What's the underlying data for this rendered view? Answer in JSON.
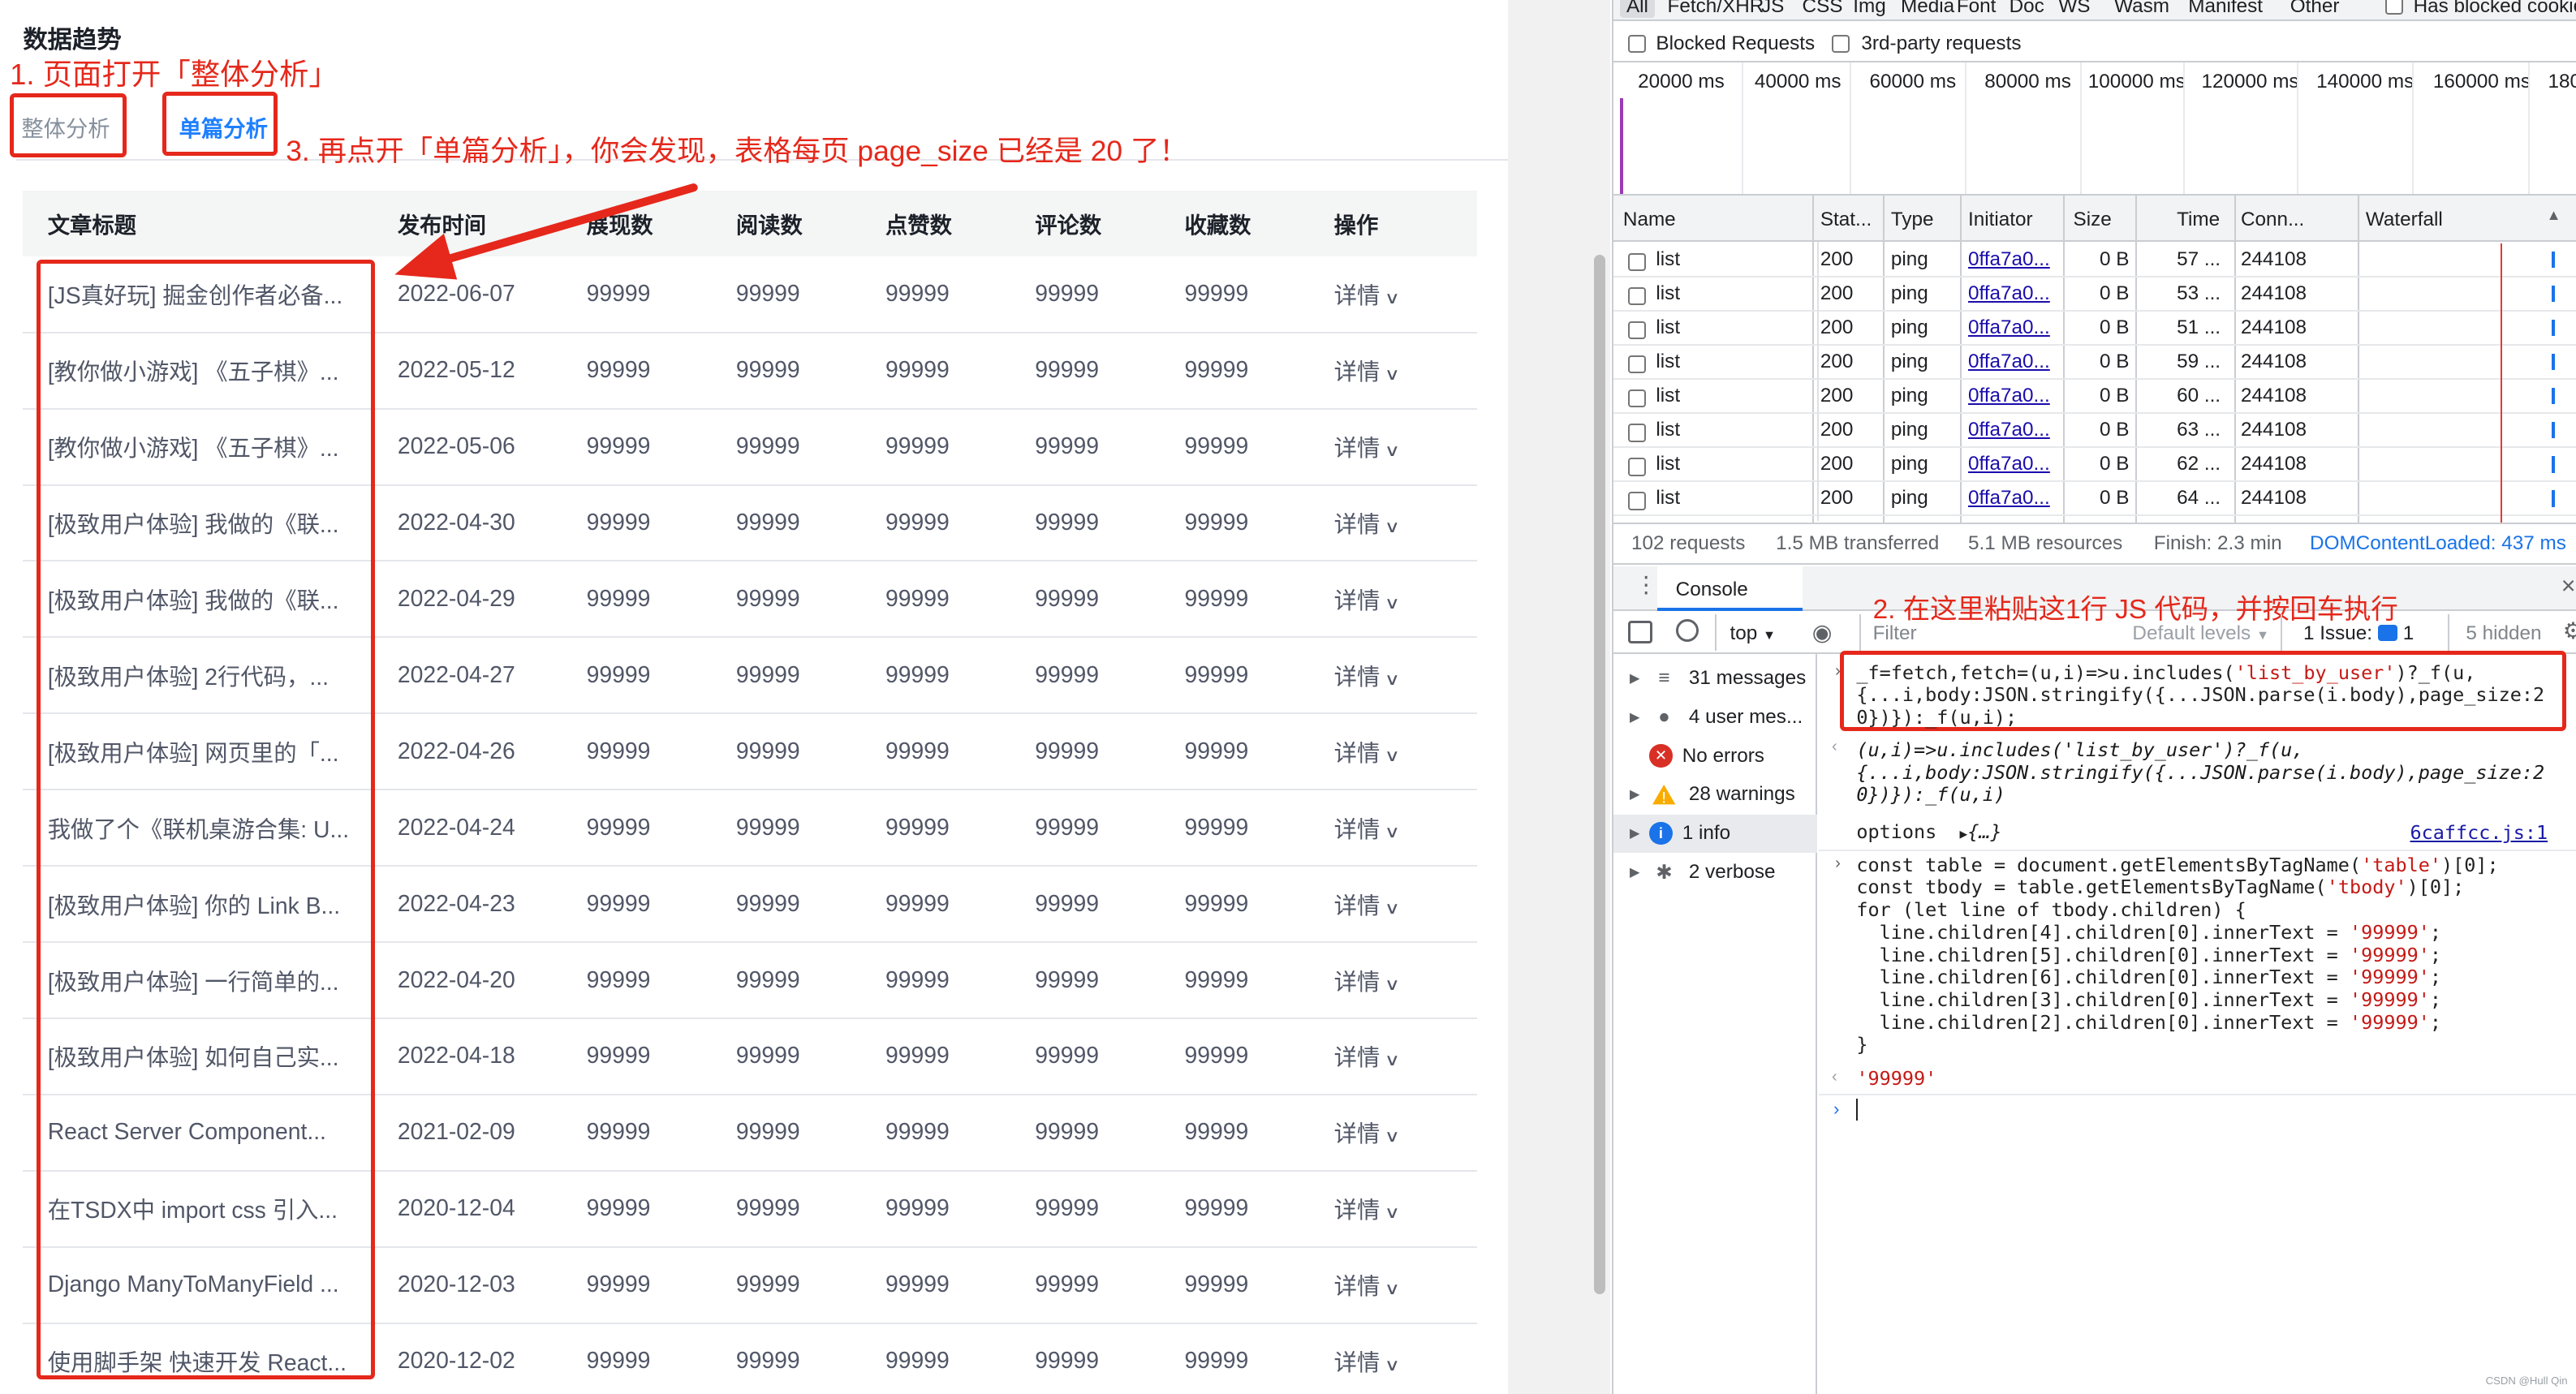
{
  "left": {
    "page_title": "数据趋势",
    "step1": "1. 页面打开「整体分析」",
    "tab_overall": "整体分析",
    "tab_single": "单篇分析",
    "step3": "3. 再点开「单篇分析」，你会发现，表格每页 page_size 已经是 20 了！",
    "table": {
      "headers": [
        "文章标题",
        "发布时间",
        "展现数",
        "阅读数",
        "点赞数",
        "评论数",
        "收藏数",
        "操作"
      ],
      "rows": [
        {
          "title": "[JS真好玩] 掘金创作者必备...",
          "date": "2022-06-07"
        },
        {
          "title": "[教你做小游戏] 《五子棋》...",
          "date": "2022-05-12"
        },
        {
          "title": "[教你做小游戏] 《五子棋》...",
          "date": "2022-05-06"
        },
        {
          "title": "[极致用户体验] 我做的《联...",
          "date": "2022-04-30"
        },
        {
          "title": "[极致用户体验] 我做的《联...",
          "date": "2022-04-29"
        },
        {
          "title": "[极致用户体验] 2行代码，...",
          "date": "2022-04-27"
        },
        {
          "title": "[极致用户体验] 网页里的「...",
          "date": "2022-04-26"
        },
        {
          "title": "我做了个《联机桌游合集: U...",
          "date": "2022-04-24"
        },
        {
          "title": "[极致用户体验] 你的 Link B...",
          "date": "2022-04-23"
        },
        {
          "title": "[极致用户体验] 一行简单的...",
          "date": "2022-04-20"
        },
        {
          "title": "[极致用户体验] 如何自己实...",
          "date": "2022-04-18"
        },
        {
          "title": "React Server Component...",
          "date": "2021-02-09"
        },
        {
          "title": "在TSDX中 import css 引入...",
          "date": "2020-12-04"
        },
        {
          "title": "Django ManyToManyField ...",
          "date": "2020-12-03"
        },
        {
          "title": "使用脚手架 快速开发 React...",
          "date": "2020-12-02"
        }
      ],
      "metric_value": "99999",
      "op_label": "详情"
    }
  },
  "devtools": {
    "filter_tabs": [
      "All",
      "Fetch/XHR",
      "JS",
      "CSS",
      "Img",
      "Media",
      "Font",
      "Doc",
      "WS",
      "Wasm",
      "Manifest",
      "Other"
    ],
    "has_blocked": "Has blocked cookies",
    "blocked_requests": "Blocked Requests",
    "third_party": "3rd-party requests",
    "timeline_ticks": [
      "20000 ms",
      "40000 ms",
      "60000 ms",
      "80000 ms",
      "100000 ms",
      "120000 ms",
      "140000 ms",
      "160000 ms",
      "180"
    ],
    "columns": [
      "Name",
      "Stat...",
      "Type",
      "Initiator",
      "Size",
      "Time",
      "Conn...",
      "Waterfall"
    ],
    "rows": [
      {
        "name": "list",
        "status": "200",
        "type": "ping",
        "initiator": "0ffa7a0...",
        "size": "0 B",
        "time": "57 ...",
        "conn": "244108"
      },
      {
        "name": "list",
        "status": "200",
        "type": "ping",
        "initiator": "0ffa7a0...",
        "size": "0 B",
        "time": "53 ...",
        "conn": "244108"
      },
      {
        "name": "list",
        "status": "200",
        "type": "ping",
        "initiator": "0ffa7a0...",
        "size": "0 B",
        "time": "51 ...",
        "conn": "244108"
      },
      {
        "name": "list",
        "status": "200",
        "type": "ping",
        "initiator": "0ffa7a0...",
        "size": "0 B",
        "time": "59 ...",
        "conn": "244108"
      },
      {
        "name": "list",
        "status": "200",
        "type": "ping",
        "initiator": "0ffa7a0...",
        "size": "0 B",
        "time": "60 ...",
        "conn": "244108"
      },
      {
        "name": "list",
        "status": "200",
        "type": "ping",
        "initiator": "0ffa7a0...",
        "size": "0 B",
        "time": "63 ...",
        "conn": "244108"
      },
      {
        "name": "list",
        "status": "200",
        "type": "ping",
        "initiator": "0ffa7a0...",
        "size": "0 B",
        "time": "62 ...",
        "conn": "244108"
      },
      {
        "name": "list",
        "status": "200",
        "type": "ping",
        "initiator": "0ffa7a0...",
        "size": "0 B",
        "time": "64 ...",
        "conn": "244108"
      }
    ],
    "summary": {
      "requests": "102 requests",
      "transferred": "1.5 MB transferred",
      "resources": "5.1 MB resources",
      "finish": "Finish: 2.3 min",
      "dcl": "DOMContentLoaded: 437 ms"
    },
    "console_tab": "Console",
    "step2": "2. 在这里粘贴这1行 JS 代码，并按回车执行",
    "toolbar": {
      "context": "top",
      "filter_placeholder": "Filter",
      "levels": "Default levels",
      "issues_label": "1 Issue:",
      "issues_count": "1",
      "hidden": "5 hidden"
    },
    "sidebar": [
      {
        "label": "31 messages",
        "icon": "list-icon"
      },
      {
        "label": "4 user mes...",
        "icon": "user-icon"
      },
      {
        "label": "No errors",
        "icon": "error-icon"
      },
      {
        "label": "28 warnings",
        "icon": "warning-icon"
      },
      {
        "label": "1 info",
        "icon": "info-icon"
      },
      {
        "label": "2 verbose",
        "icon": "bug-icon"
      }
    ],
    "code": {
      "input1_l1": "_f=fetch,fetch=(u,i)=>u.includes(",
      "input1_s1": "'list_by_user'",
      "input1_l1b": ")?_f(u,",
      "input1_l2": "{...i,body:JSON.stringify({...JSON.parse(i.body),page_size:2",
      "input1_l3": "0})}):_f(u,i);",
      "output1_l1": "(u,i)=>u.includes('list_by_user')?_f(u,",
      "output1_l2": "{...i,body:JSON.stringify({...JSON.parse(i.body),page_size:2",
      "output1_l3": "0})}):_f(u,i)",
      "options_label": "options",
      "options_value": "{…}",
      "source_link": "6caffcc.js:1",
      "input2_l1": "const table = document.getElementsByTagName(",
      "input2_s1": "'table'",
      "input2_l1b": ")[0];",
      "input2_l2": "const tbody = table.getElementsByTagName(",
      "input2_s2": "'tbody'",
      "input2_l2b": ")[0];",
      "input2_l3": "for (let line of tbody.children) {",
      "input2_lines": [
        {
          "pre": "  line.children[4].children[0].innerText = ",
          "s": "'99999'",
          "post": ";"
        },
        {
          "pre": "  line.children[5].children[0].innerText = ",
          "s": "'99999'",
          "post": ";"
        },
        {
          "pre": "  line.children[6].children[0].innerText = ",
          "s": "'99999'",
          "post": ";"
        },
        {
          "pre": "  line.children[3].children[0].innerText = ",
          "s": "'99999'",
          "post": ";"
        },
        {
          "pre": "  line.children[2].children[0].innerText = ",
          "s": "'99999'",
          "post": ";"
        }
      ],
      "input2_close": "}",
      "result2": "'99999'"
    },
    "watermark": "CSDN @Hull Qin"
  }
}
